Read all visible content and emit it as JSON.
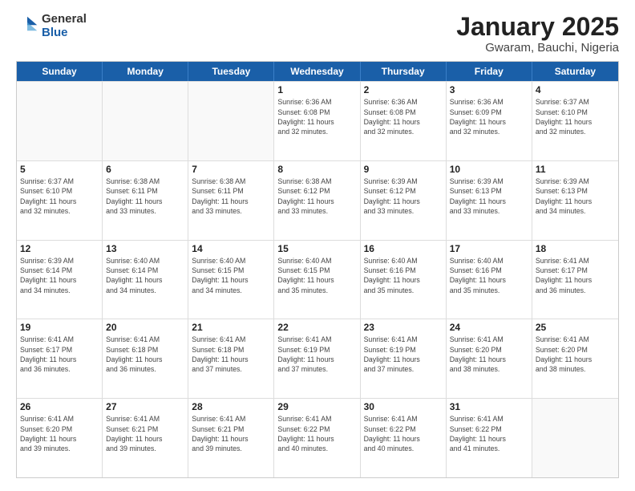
{
  "logo": {
    "general": "General",
    "blue": "Blue"
  },
  "title": {
    "month": "January 2025",
    "location": "Gwaram, Bauchi, Nigeria"
  },
  "header_days": [
    "Sunday",
    "Monday",
    "Tuesday",
    "Wednesday",
    "Thursday",
    "Friday",
    "Saturday"
  ],
  "weeks": [
    [
      {
        "day": "",
        "info": "",
        "empty": true
      },
      {
        "day": "",
        "info": "",
        "empty": true
      },
      {
        "day": "",
        "info": "",
        "empty": true
      },
      {
        "day": "1",
        "info": "Sunrise: 6:36 AM\nSunset: 6:08 PM\nDaylight: 11 hours\nand 32 minutes."
      },
      {
        "day": "2",
        "info": "Sunrise: 6:36 AM\nSunset: 6:08 PM\nDaylight: 11 hours\nand 32 minutes."
      },
      {
        "day": "3",
        "info": "Sunrise: 6:36 AM\nSunset: 6:09 PM\nDaylight: 11 hours\nand 32 minutes."
      },
      {
        "day": "4",
        "info": "Sunrise: 6:37 AM\nSunset: 6:10 PM\nDaylight: 11 hours\nand 32 minutes."
      }
    ],
    [
      {
        "day": "5",
        "info": "Sunrise: 6:37 AM\nSunset: 6:10 PM\nDaylight: 11 hours\nand 32 minutes."
      },
      {
        "day": "6",
        "info": "Sunrise: 6:38 AM\nSunset: 6:11 PM\nDaylight: 11 hours\nand 33 minutes."
      },
      {
        "day": "7",
        "info": "Sunrise: 6:38 AM\nSunset: 6:11 PM\nDaylight: 11 hours\nand 33 minutes."
      },
      {
        "day": "8",
        "info": "Sunrise: 6:38 AM\nSunset: 6:12 PM\nDaylight: 11 hours\nand 33 minutes."
      },
      {
        "day": "9",
        "info": "Sunrise: 6:39 AM\nSunset: 6:12 PM\nDaylight: 11 hours\nand 33 minutes."
      },
      {
        "day": "10",
        "info": "Sunrise: 6:39 AM\nSunset: 6:13 PM\nDaylight: 11 hours\nand 33 minutes."
      },
      {
        "day": "11",
        "info": "Sunrise: 6:39 AM\nSunset: 6:13 PM\nDaylight: 11 hours\nand 34 minutes."
      }
    ],
    [
      {
        "day": "12",
        "info": "Sunrise: 6:39 AM\nSunset: 6:14 PM\nDaylight: 11 hours\nand 34 minutes."
      },
      {
        "day": "13",
        "info": "Sunrise: 6:40 AM\nSunset: 6:14 PM\nDaylight: 11 hours\nand 34 minutes."
      },
      {
        "day": "14",
        "info": "Sunrise: 6:40 AM\nSunset: 6:15 PM\nDaylight: 11 hours\nand 34 minutes."
      },
      {
        "day": "15",
        "info": "Sunrise: 6:40 AM\nSunset: 6:15 PM\nDaylight: 11 hours\nand 35 minutes."
      },
      {
        "day": "16",
        "info": "Sunrise: 6:40 AM\nSunset: 6:16 PM\nDaylight: 11 hours\nand 35 minutes."
      },
      {
        "day": "17",
        "info": "Sunrise: 6:40 AM\nSunset: 6:16 PM\nDaylight: 11 hours\nand 35 minutes."
      },
      {
        "day": "18",
        "info": "Sunrise: 6:41 AM\nSunset: 6:17 PM\nDaylight: 11 hours\nand 36 minutes."
      }
    ],
    [
      {
        "day": "19",
        "info": "Sunrise: 6:41 AM\nSunset: 6:17 PM\nDaylight: 11 hours\nand 36 minutes."
      },
      {
        "day": "20",
        "info": "Sunrise: 6:41 AM\nSunset: 6:18 PM\nDaylight: 11 hours\nand 36 minutes."
      },
      {
        "day": "21",
        "info": "Sunrise: 6:41 AM\nSunset: 6:18 PM\nDaylight: 11 hours\nand 37 minutes."
      },
      {
        "day": "22",
        "info": "Sunrise: 6:41 AM\nSunset: 6:19 PM\nDaylight: 11 hours\nand 37 minutes."
      },
      {
        "day": "23",
        "info": "Sunrise: 6:41 AM\nSunset: 6:19 PM\nDaylight: 11 hours\nand 37 minutes."
      },
      {
        "day": "24",
        "info": "Sunrise: 6:41 AM\nSunset: 6:20 PM\nDaylight: 11 hours\nand 38 minutes."
      },
      {
        "day": "25",
        "info": "Sunrise: 6:41 AM\nSunset: 6:20 PM\nDaylight: 11 hours\nand 38 minutes."
      }
    ],
    [
      {
        "day": "26",
        "info": "Sunrise: 6:41 AM\nSunset: 6:20 PM\nDaylight: 11 hours\nand 39 minutes."
      },
      {
        "day": "27",
        "info": "Sunrise: 6:41 AM\nSunset: 6:21 PM\nDaylight: 11 hours\nand 39 minutes."
      },
      {
        "day": "28",
        "info": "Sunrise: 6:41 AM\nSunset: 6:21 PM\nDaylight: 11 hours\nand 39 minutes."
      },
      {
        "day": "29",
        "info": "Sunrise: 6:41 AM\nSunset: 6:22 PM\nDaylight: 11 hours\nand 40 minutes."
      },
      {
        "day": "30",
        "info": "Sunrise: 6:41 AM\nSunset: 6:22 PM\nDaylight: 11 hours\nand 40 minutes."
      },
      {
        "day": "31",
        "info": "Sunrise: 6:41 AM\nSunset: 6:22 PM\nDaylight: 11 hours\nand 41 minutes."
      },
      {
        "day": "",
        "info": "",
        "empty": true
      }
    ]
  ]
}
